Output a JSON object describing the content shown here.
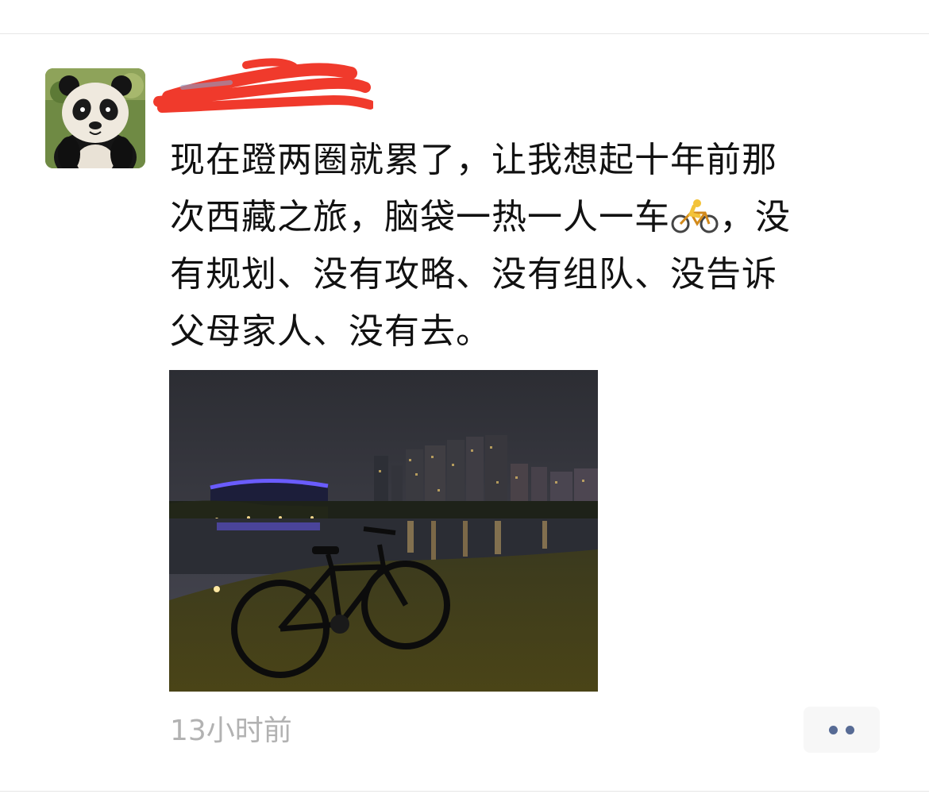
{
  "post": {
    "username": "",
    "text_line1": "现在蹬两圈就累了，让我想起十年前那",
    "text_line2_before": "次西藏之旅，脑袋一热一人一车",
    "text_line2_after": "，没",
    "text_line3": "有规划、没有攻略、没有组队、没告诉",
    "text_line4": "父母家人、没有去。",
    "emoji": "bicyclist-emoji",
    "timestamp": "13小时前"
  },
  "colors": {
    "username": "#576b95",
    "text": "#111111",
    "timestamp": "#b2b2b2",
    "redaction": "#f03a2c",
    "more_dots": "#576b95"
  },
  "icons": {
    "more": "more-dots-icon"
  }
}
